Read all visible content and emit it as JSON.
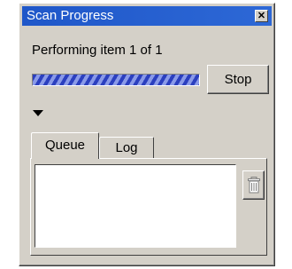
{
  "window": {
    "title": "Scan Progress",
    "close_glyph": "✕"
  },
  "status": {
    "text": "Performing item 1 of 1",
    "progress_fraction": 1.0
  },
  "buttons": {
    "stop_label": "Stop",
    "expand_icon": "triangle-down-icon",
    "delete_icon": "trash-icon"
  },
  "tabs": [
    {
      "label": "Queue",
      "selected": true
    },
    {
      "label": "Log",
      "selected": false
    }
  ],
  "colors": {
    "titlebar": "#1f57c9",
    "progress": "#2b3fbf",
    "face": "#d4d0c8"
  }
}
